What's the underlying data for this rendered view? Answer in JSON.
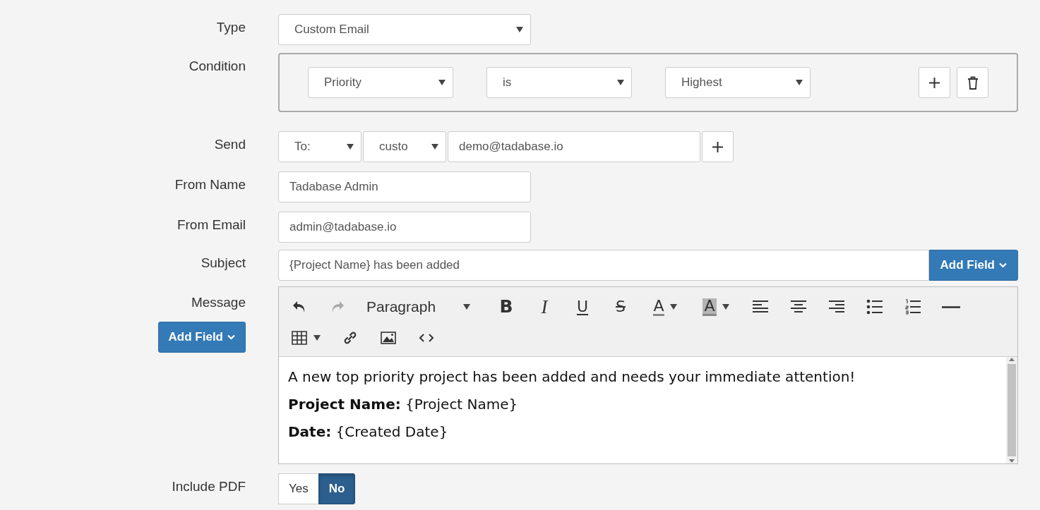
{
  "type": {
    "label": "Type",
    "value": "Custom Email"
  },
  "condition": {
    "label": "Condition",
    "selects": [
      "Priority",
      "is",
      "Highest"
    ]
  },
  "send": {
    "label": "Send",
    "recipient_type": "To:",
    "source": "custo",
    "email": "demo@tadabase.io"
  },
  "from_name": {
    "label": "From Name",
    "value": "Tadabase Admin"
  },
  "from_email": {
    "label": "From Email",
    "value": "admin@tadabase.io"
  },
  "subject": {
    "label": "Subject",
    "value": "{Project Name} has been added",
    "add_field": "Add Field"
  },
  "message": {
    "label": "Message",
    "add_field": "Add Field",
    "toolbar_rows": [
      [
        {
          "kind": "undo",
          "disabled": false
        },
        {
          "kind": "redo",
          "disabled": true
        },
        {
          "kind": "format",
          "label": "Paragraph",
          "disabled": false
        },
        {
          "kind": "bold",
          "glyph": "B",
          "disabled": false
        },
        {
          "kind": "italic",
          "glyph": "I",
          "disabled": false
        },
        {
          "kind": "underline",
          "glyph": "U",
          "disabled": false
        },
        {
          "kind": "strike",
          "glyph": "S",
          "disabled": false
        },
        {
          "kind": "forecolor",
          "glyph": "A",
          "disabled": false
        },
        {
          "kind": "backcolor",
          "glyph": "A",
          "disabled": false
        },
        {
          "kind": "align-left",
          "disabled": false
        },
        {
          "kind": "align-center",
          "disabled": false
        },
        {
          "kind": "align-right",
          "disabled": false
        },
        {
          "kind": "bullets",
          "disabled": false
        },
        {
          "kind": "numbers",
          "disabled": false
        },
        {
          "kind": "rule",
          "disabled": false
        }
      ],
      [
        {
          "kind": "table",
          "disabled": false
        },
        {
          "kind": "link",
          "disabled": false
        },
        {
          "kind": "image",
          "disabled": false
        },
        {
          "kind": "code",
          "disabled": false
        }
      ]
    ],
    "paragraphs": [
      "A new top priority project has been added and needs your immediate attention!",
      "**Project Name:** {Project Name}",
      "**Date:** {Created Date}"
    ]
  },
  "include_pdf": {
    "label": "Include PDF",
    "options": [
      {
        "label": "Yes",
        "selected": false
      },
      {
        "label": "No",
        "selected": true
      }
    ]
  }
}
